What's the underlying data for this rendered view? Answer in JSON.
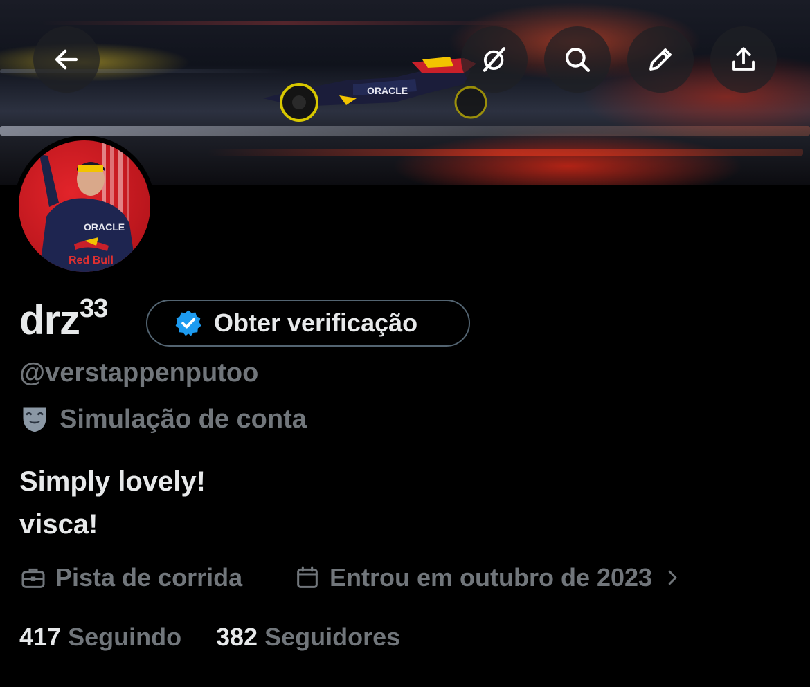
{
  "header": {
    "back_icon": "arrow-left-icon",
    "grok_icon": "grok-icon",
    "search_icon": "search-icon",
    "edit_icon": "pencil-icon",
    "share_icon": "share-upload-icon"
  },
  "profile": {
    "display_name": "drz",
    "display_name_superscript": "33",
    "verify_button_label": "Obter verificação",
    "handle": "@verstappenputoo",
    "parody_label": "Simulação de conta",
    "bio_line1": "Simply lovely!",
    "bio_line2": "visca!",
    "profession": "Pista de corrida",
    "joined": "Entrou em outubro de 2023",
    "following_count": "417",
    "following_label": "Seguindo",
    "followers_count": "382",
    "followers_label": "Seguidores"
  },
  "colors": {
    "background": "#000000",
    "primary_text": "#e7e9ea",
    "secondary_text": "#71767b",
    "verified_blue": "#1d9bf0",
    "button_border": "#536471"
  }
}
